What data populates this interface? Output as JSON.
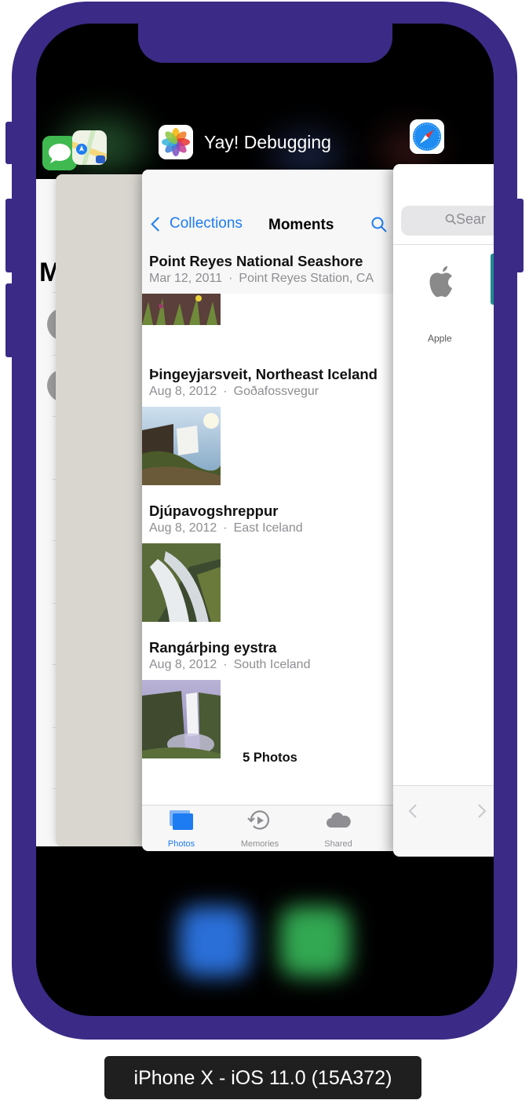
{
  "caption": "iPhone X - iOS 11.0 (15A372)",
  "switcher": {
    "app_title": "Yay! Debugging"
  },
  "messages_card": {
    "title_partial": "M"
  },
  "photos": {
    "nav": {
      "back_label": "Collections",
      "title": "Moments"
    },
    "sections": [
      {
        "title": "Point Reyes National Seashore",
        "date": "Mar 12, 2011",
        "location": "Point Reyes Station, CA"
      },
      {
        "title": "Þingeyjarsveit, Northeast Iceland",
        "date": "Aug 8, 2012",
        "location": "Goðafossvegur"
      },
      {
        "title": "Djúpavogshreppur",
        "date": "Aug 8, 2012",
        "location": "East Iceland"
      },
      {
        "title": "Rangárþing eystra",
        "date": "Aug 8, 2012",
        "location": "South Iceland"
      }
    ],
    "separator": "·",
    "count_label": "5 Photos",
    "tabs": [
      {
        "label": "Photos",
        "icon": "photos-tab-icon",
        "active": true
      },
      {
        "label": "Memories",
        "icon": "memories-icon",
        "active": false
      },
      {
        "label": "Shared",
        "icon": "cloud-icon",
        "active": false
      }
    ]
  },
  "safari": {
    "search_placeholder": "Sear",
    "favorite_label": "Apple"
  },
  "colors": {
    "frame": "#3b2a86",
    "ios_blue": "#1e7cf2",
    "caption_bg": "#1f1f1f"
  }
}
